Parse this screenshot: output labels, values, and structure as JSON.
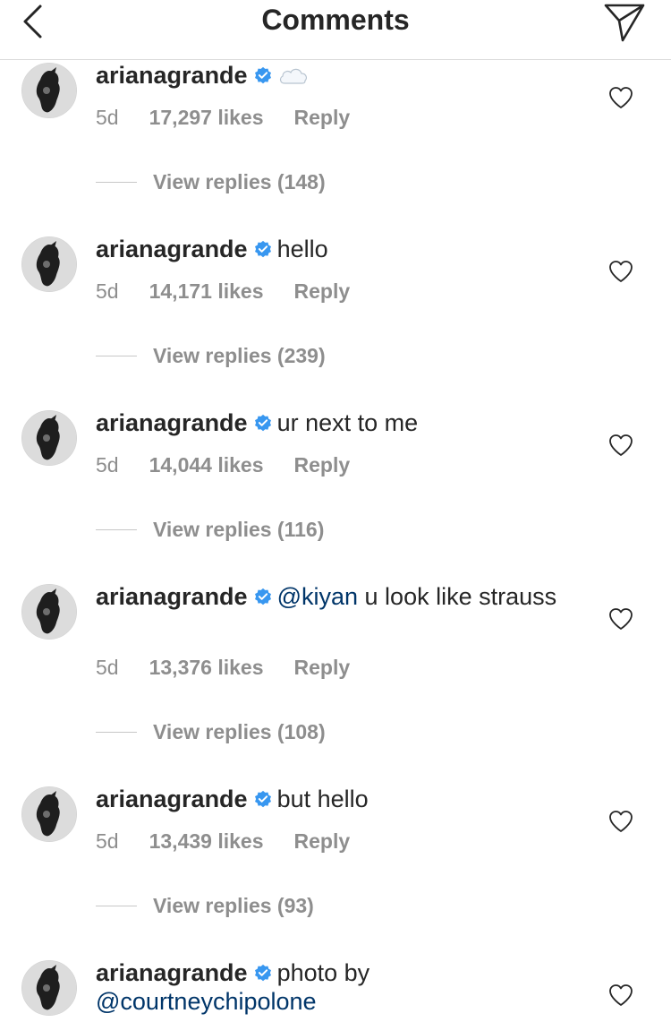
{
  "header": {
    "title": "Comments",
    "back_icon": "chevron-left-icon",
    "send_icon": "paper-plane-icon"
  },
  "colors": {
    "verified": "#3897f0",
    "mention": "#003569",
    "meta": "#8e8e8e",
    "text": "#262626"
  },
  "comments": [
    {
      "username": "arianagrande",
      "text": "",
      "emoji": "cloud",
      "time": "5d",
      "likes": "17,297 likes",
      "reply": "Reply",
      "view_replies": "View replies (148)"
    },
    {
      "username": "arianagrande",
      "text": "hello",
      "time": "5d",
      "likes": "14,171 likes",
      "reply": "Reply",
      "view_replies": "View replies (239)"
    },
    {
      "username": "arianagrande",
      "text": "ur next to me",
      "time": "5d",
      "likes": "14,044 likes",
      "reply": "Reply",
      "view_replies": "View replies (116)"
    },
    {
      "username": "arianagrande",
      "mention": "@kiyan",
      "text": " u look like strauss",
      "time": "5d",
      "likes": "13,376 likes",
      "reply": "Reply",
      "view_replies": "View replies (108)"
    },
    {
      "username": "arianagrande",
      "text": "but hello",
      "time": "5d",
      "likes": "13,439 likes",
      "reply": "Reply",
      "view_replies": "View replies (93)"
    },
    {
      "username": "arianagrande",
      "text": "photo by ",
      "mention_after": "@courtneychipolone"
    }
  ]
}
